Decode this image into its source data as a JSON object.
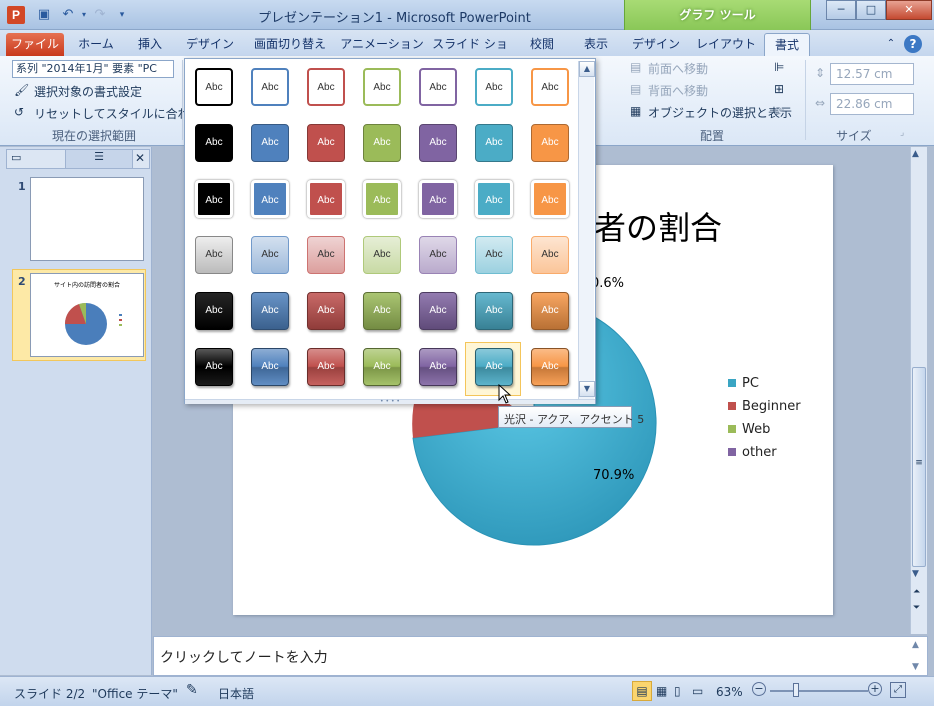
{
  "window": {
    "title": "プレゼンテーション1 - Microsoft PowerPoint",
    "tool_group": "グラフ ツール",
    "minimize": "─",
    "maximize": "□",
    "close": "✕"
  },
  "tabs": [
    "ファイル",
    "ホーム",
    "挿入",
    "デザイン",
    "画面切り替え",
    "アニメーション",
    "スライド ショー",
    "校閲",
    "表示",
    "デザイン",
    "レイアウト",
    "書式"
  ],
  "ribbon": {
    "selection_box": "系列 \"2014年1月\" 要素 \"PC",
    "format_selection": "選択対象の書式設定",
    "reset_style": "リセットしてスタイルに合わせる",
    "group_current": "現在の選択範囲",
    "bring_forward": "前面へ移動",
    "send_backward": "背面へ移動",
    "selection_pane": "オブジェクトの選択と表示",
    "group_arrange": "配置",
    "height": "12.57 cm",
    "width": "22.86 cm",
    "group_size": "サイズ"
  },
  "slides": {
    "slide1_num": "1",
    "slide2_num": "2",
    "slide2_mini_title": "サイト内の訪問者の割合"
  },
  "slide": {
    "title_visible": "者の割合",
    "label_top": "0.6%",
    "label_pc": "70.9%",
    "legend": [
      {
        "label": "PC",
        "color": "#3aa5c3"
      },
      {
        "label": "Beginner",
        "color": "#c0504d"
      },
      {
        "label": "Web",
        "color": "#9bbb59"
      },
      {
        "label": "other",
        "color": "#8064a2"
      }
    ]
  },
  "gallery": {
    "swatch_label": "Abc",
    "accent_colors": [
      "#000000",
      "#4f81bd",
      "#c0504d",
      "#9bbb59",
      "#8064a2",
      "#4bacc6",
      "#f79646"
    ],
    "tooltip": "光沢 - アクア、アクセント 5",
    "selected_row": 5,
    "selected_col": 5
  },
  "notes": {
    "placeholder": "クリックしてノートを入力"
  },
  "status": {
    "slide": "スライド 2/2",
    "theme": "\"Office テーマ\"",
    "language": "日本語",
    "zoom": "63%"
  }
}
